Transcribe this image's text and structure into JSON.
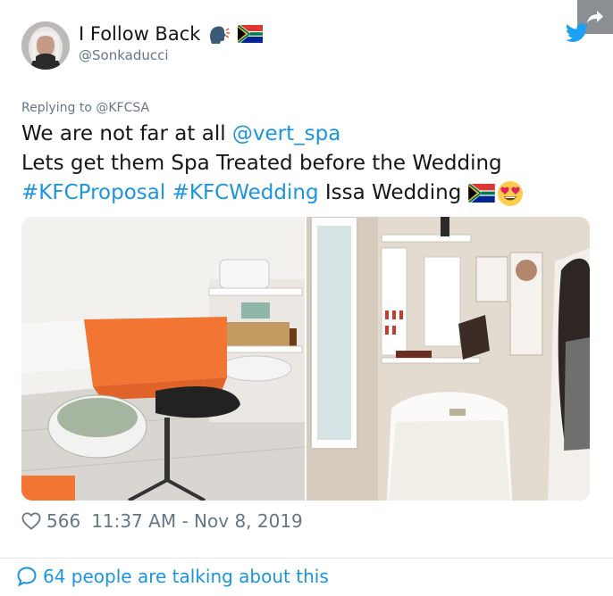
{
  "user": {
    "display_name": "I Follow Back",
    "handle": "@Sonkaducci",
    "name_icons": [
      "speaking-head-emoji",
      "south-africa-flag"
    ]
  },
  "tweet": {
    "replying_to": "Replying to @KFCSA",
    "line1_text": "We are not far at all ",
    "line1_mention": "@vert_spa",
    "line2_text": "Lets get them Spa Treated before the Wedding",
    "line3_hashtag1": "#KFCProposal",
    "line3_hashtag2": "#KFCWedding",
    "line3_text": " Issa Wedding ",
    "line3_icons": [
      "south-africa-flag",
      "heart-eyes-emoji"
    ]
  },
  "media": {
    "photos": [
      "spa-treatment-room-left",
      "spa-treatment-room-right"
    ]
  },
  "meta": {
    "likes": "566",
    "timestamp": "11:37 AM - Nov 8, 2019"
  },
  "footer": {
    "talking_text": "64 people are talking about this"
  },
  "colors": {
    "link": "#1b95e0",
    "text": "#14171a",
    "muted": "#657786",
    "twitter_blue": "#1da1f2"
  }
}
